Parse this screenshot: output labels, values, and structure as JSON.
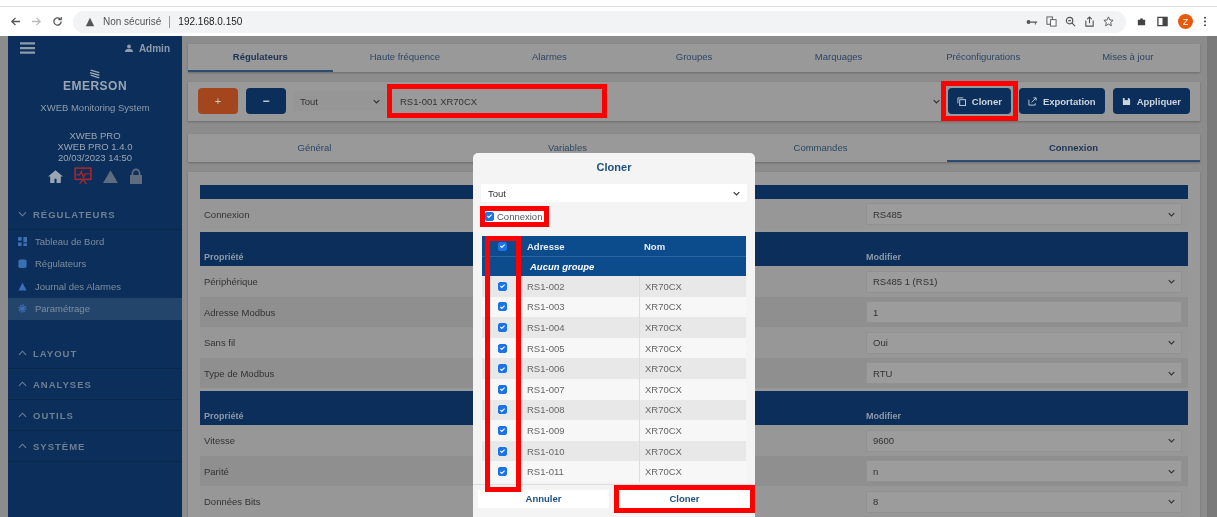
{
  "browser": {
    "security": "Non sécurisé",
    "url": "192.168.0.150",
    "profile_initial": "Z"
  },
  "sidebar": {
    "user": "Admin",
    "brand": "EMERSON",
    "subtitle": "XWEB Monitoring System",
    "device_lines": [
      "XWEB PRO",
      "XWEB PRO 1.4.0",
      "20/03/2023 14:50"
    ],
    "sections": [
      {
        "label": "RÉGULATEURS",
        "expanded": true,
        "items": [
          {
            "label": "Tableau de Bord",
            "kind": "dashboard",
            "selected": false
          },
          {
            "label": "Régulateurs",
            "kind": "database",
            "selected": false
          },
          {
            "label": "Journal des Alarmes",
            "kind": "warning",
            "selected": false
          },
          {
            "label": "Paramétrage",
            "kind": "gear",
            "selected": true
          }
        ]
      },
      {
        "label": "LAYOUT",
        "expanded": false
      },
      {
        "label": "ANALYSES",
        "expanded": false
      },
      {
        "label": "OUTILS",
        "expanded": false
      },
      {
        "label": "SYSTÈME",
        "expanded": false
      }
    ]
  },
  "main_tabs": [
    {
      "label": "Régulateurs",
      "selected": true
    },
    {
      "label": "Haute fréquence",
      "selected": false
    },
    {
      "label": "Alarmes",
      "selected": false
    },
    {
      "label": "Groupes",
      "selected": false
    },
    {
      "label": "Marquages",
      "selected": false
    },
    {
      "label": "Préconfigurations",
      "selected": false
    },
    {
      "label": "Mises à jour",
      "selected": false
    }
  ],
  "toolbar": {
    "add": "+",
    "remove": "−",
    "filter": "Tout",
    "device": {
      "value": "RS1-001 XR70CX",
      "highlighted": true
    },
    "buttons": [
      {
        "label": "Cloner",
        "kind": "clone",
        "highlighted": true
      },
      {
        "label": "Exportation",
        "kind": "export",
        "highlighted": false
      },
      {
        "label": "Appliquer",
        "kind": "apply",
        "highlighted": false
      }
    ]
  },
  "sub_tabs": [
    {
      "label": "Général",
      "selected": false
    },
    {
      "label": "Variables",
      "selected": false
    },
    {
      "label": "Commandes",
      "selected": false
    },
    {
      "label": "Connexion",
      "selected": true
    }
  ],
  "form": {
    "sections": [
      {
        "rows": [
          {
            "label": "Connexion",
            "value": "RS485",
            "kind": "select"
          }
        ]
      },
      {
        "header": "Propriété",
        "value_header": "Modifier",
        "rows": [
          {
            "label": "Périphérique",
            "value": "RS485 1 (RS1)",
            "kind": "select"
          },
          {
            "label": "Adresse Modbus",
            "value": "1",
            "kind": "input"
          },
          {
            "label": "Sans fil",
            "value": "Oui",
            "kind": "select"
          },
          {
            "label": "Type de Modbus",
            "value": "RTU",
            "kind": "select"
          }
        ]
      },
      {
        "header": "Propriété",
        "value_header": "Modifier",
        "rows": [
          {
            "label": "Vitesse",
            "value": "9600",
            "kind": "select"
          },
          {
            "label": "Parité",
            "value": "n",
            "kind": "select"
          },
          {
            "label": "Données Bits",
            "value": "8",
            "kind": "select"
          }
        ]
      }
    ]
  },
  "modal": {
    "title": "Cloner",
    "filter": "Tout",
    "option": {
      "label": "Connexion",
      "checked": true,
      "highlighted": true
    },
    "table": {
      "columns": [
        "Adresse",
        "Nom"
      ],
      "all_checked": true,
      "checkbox_column_highlighted": true,
      "group": "Aucun groupe",
      "rows": [
        {
          "address": "RS1-002",
          "name": "XR70CX",
          "checked": true
        },
        {
          "address": "RS1-003",
          "name": "XR70CX",
          "checked": true
        },
        {
          "address": "RS1-004",
          "name": "XR70CX",
          "checked": true
        },
        {
          "address": "RS1-005",
          "name": "XR70CX",
          "checked": true
        },
        {
          "address": "RS1-006",
          "name": "XR70CX",
          "checked": true
        },
        {
          "address": "RS1-007",
          "name": "XR70CX",
          "checked": true
        },
        {
          "address": "RS1-008",
          "name": "XR70CX",
          "checked": true
        },
        {
          "address": "RS1-009",
          "name": "XR70CX",
          "checked": true
        },
        {
          "address": "RS1-010",
          "name": "XR70CX",
          "checked": true
        },
        {
          "address": "RS1-011",
          "name": "XR70CX",
          "checked": true
        }
      ]
    },
    "buttons": [
      {
        "label": "Annuler",
        "highlighted": false
      },
      {
        "label": "Cloner",
        "highlighted": true
      }
    ]
  }
}
